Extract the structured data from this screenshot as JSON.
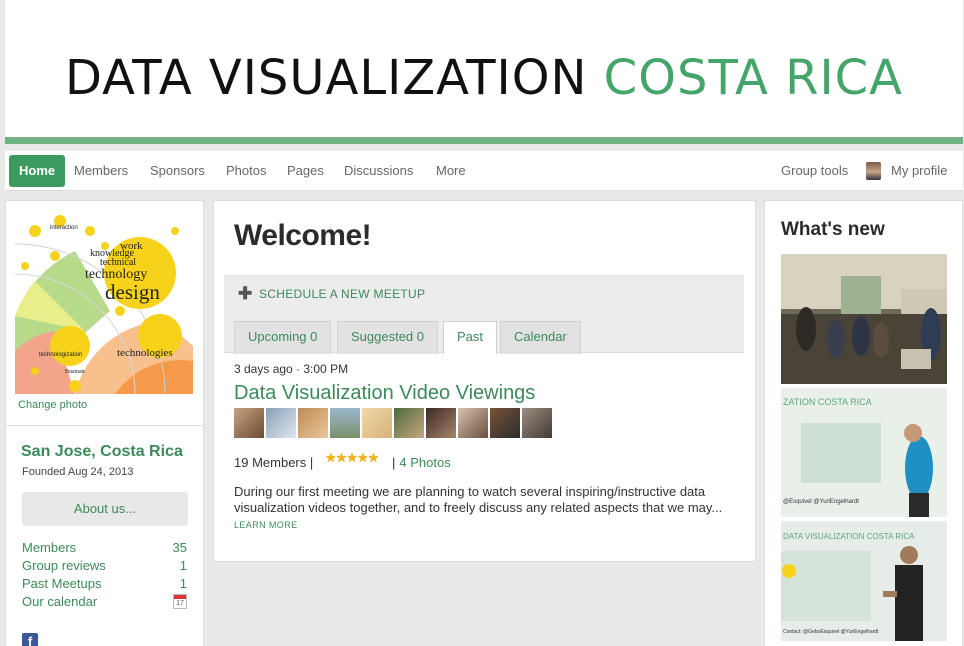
{
  "banner": {
    "title_part1": "DATA VISUALIZATION",
    "title_part2": "COSTA RICA"
  },
  "nav": {
    "home": "Home",
    "members": "Members",
    "sponsors": "Sponsors",
    "photos": "Photos",
    "pages": "Pages",
    "discussions": "Discussions",
    "more": "More",
    "group_tools": "Group tools",
    "my_profile": "My profile"
  },
  "sidebar": {
    "change_photo": "Change photo",
    "city": "San Jose, Costa Rica",
    "founded": "Founded Aug 24, 2013",
    "about_button": "About us...",
    "stats": [
      {
        "label": "Members",
        "value": "35"
      },
      {
        "label": "Group reviews",
        "value": "1"
      },
      {
        "label": "Past Meetups",
        "value": "1"
      },
      {
        "label": "Our calendar",
        "value": ""
      }
    ],
    "calendar_day": "17",
    "photo_words": [
      "technology",
      "design",
      "knowledge",
      "work",
      "technical",
      "technologies",
      "technologization",
      "interaction",
      "Busman"
    ]
  },
  "main": {
    "welcome": "Welcome!",
    "schedule_label": "SCHEDULE A NEW MEETUP",
    "tabs": [
      "Upcoming 0",
      "Suggested 0",
      "Past",
      "Calendar"
    ],
    "active_tab": "Past",
    "event": {
      "when": "3 days ago · 3:00 PM",
      "title": "Data Visualization Video Viewings",
      "members_label": "19 Members |",
      "stars": "★★★★★",
      "photos_separator": "|",
      "photos_label": "4 Photos",
      "description": "During our first meeting we are planning to watch several inspiring/instructive data visualization videos together, and to freely discuss any related aspects that we may...",
      "learn_more": "LEARN MORE"
    }
  },
  "whats_new": {
    "title": "What's new",
    "slide_text_a": "ZATION COSTA RICA",
    "slide_text_b": "@Esquivel   @YuriEngelhardt",
    "slide_text_c": "DATA VISUALIZATION COSTA RICA",
    "slide_text_d": "Contact: @GeboEsquivel   @YuriEngelhardt"
  },
  "colors": {
    "accent": "#3c9a5f",
    "banner_green": "#43a56a",
    "link": "#3c8a5a",
    "banner_rule": "#6fb383"
  }
}
